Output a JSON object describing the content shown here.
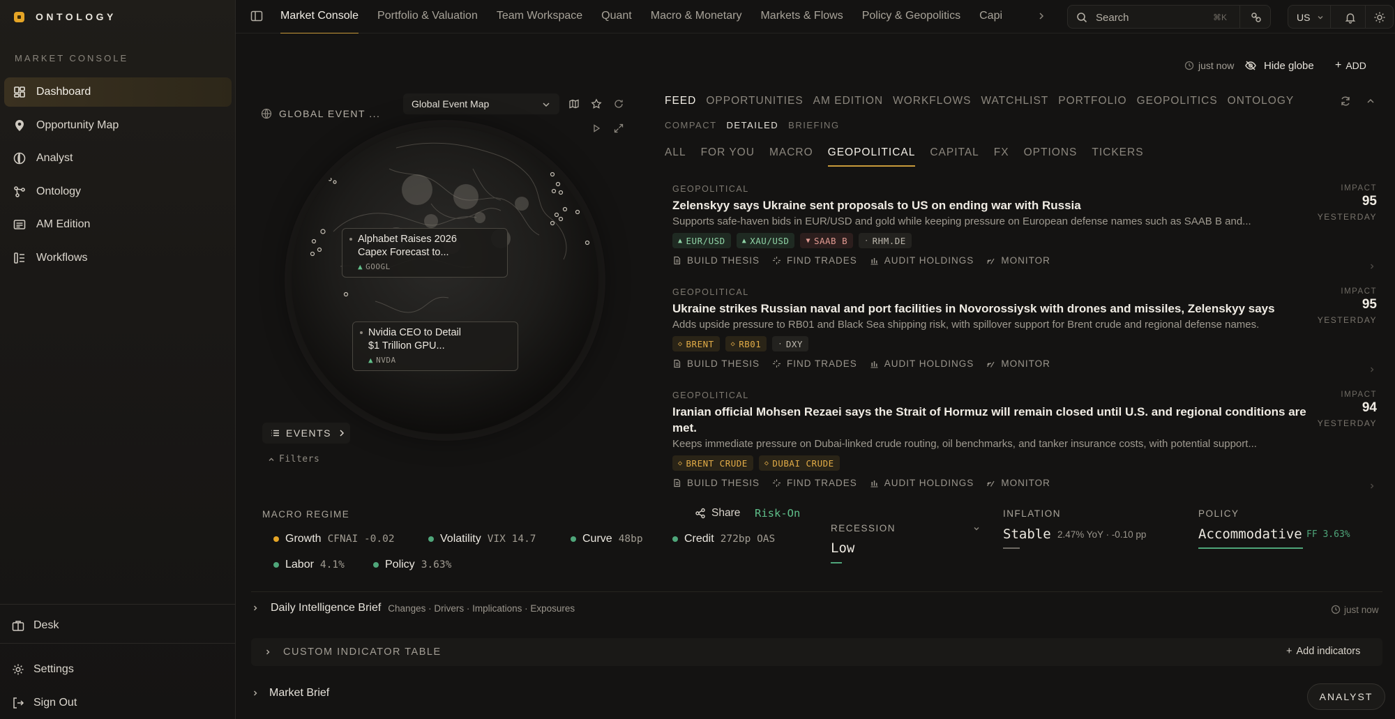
{
  "brand": {
    "name": "ONTOLOGY",
    "accent": "#e5a526"
  },
  "sidebar": {
    "section_label": "MARKET CONSOLE",
    "items": [
      {
        "label": "Dashboard",
        "icon": "dashboard-icon",
        "active": true
      },
      {
        "label": "Opportunity Map",
        "icon": "map-pin-icon"
      },
      {
        "label": "Analyst",
        "icon": "compass-icon"
      },
      {
        "label": "Ontology",
        "icon": "graph-icon"
      },
      {
        "label": "AM Edition",
        "icon": "newspaper-icon"
      },
      {
        "label": "Workflows",
        "icon": "workflow-icon"
      }
    ],
    "bottom": [
      {
        "label": "Desk",
        "icon": "briefcase-icon"
      },
      {
        "label": "Settings",
        "icon": "gear-icon"
      },
      {
        "label": "Sign Out",
        "icon": "sign-out-icon"
      }
    ]
  },
  "topbar": {
    "tabs": [
      "Market Console",
      "Portfolio & Valuation",
      "Team Workspace",
      "Quant",
      "Macro & Monetary",
      "Markets & Flows",
      "Policy & Geopolitics",
      "Capi"
    ],
    "active_tab": "Market Console",
    "search_placeholder": "Search",
    "search_shortcut": "⌘K",
    "region": "US"
  },
  "header": {
    "updated": "just now",
    "hide_globe": "Hide globe",
    "add": "ADD"
  },
  "globe": {
    "title": "GLOBAL EVENT ...",
    "map_select": "Global Event Map",
    "callouts": [
      {
        "line1": "Alphabet Raises 2026",
        "line2": "Capex Forecast to...",
        "ticker": "GOOGL"
      },
      {
        "line1": "Nvidia CEO to Detail",
        "line2": "$1 Trillion GPU...",
        "ticker": "NVDA"
      }
    ],
    "events_label": "EVENTS",
    "filters_label": "Filters"
  },
  "feed": {
    "tabs": [
      "FEED",
      "OPPORTUNITIES",
      "AM EDITION",
      "WORKFLOWS",
      "WATCHLIST",
      "PORTFOLIO",
      "GEOPOLITICS",
      "ONTOLOGY"
    ],
    "views": [
      "COMPACT",
      "DETAILED",
      "BRIEFING"
    ],
    "categories": [
      "ALL",
      "FOR YOU",
      "MACRO",
      "GEOPOLITICAL",
      "CAPITAL",
      "FX",
      "OPTIONS",
      "TICKERS"
    ],
    "impact_label": "IMPACT",
    "actions": [
      "BUILD THESIS",
      "FIND TRADES",
      "AUDIT HOLDINGS",
      "MONITOR"
    ],
    "items": [
      {
        "category": "GEOPOLITICAL",
        "headline": "Zelenskyy says Ukraine sent proposals to US on ending war with Russia",
        "summary": "Supports safe-haven bids in EUR/USD and gold while keeping pressure on European defense names such as SAAB B and...",
        "impact": "95",
        "when": "YESTERDAY",
        "chips": [
          {
            "label": "EUR/USD",
            "kind": "up",
            "mark": "▲"
          },
          {
            "label": "XAU/USD",
            "kind": "up",
            "mark": "▲"
          },
          {
            "label": "SAAB B",
            "kind": "down",
            "mark": "▼"
          },
          {
            "label": "RHM.DE",
            "kind": "nt",
            "mark": "·"
          }
        ]
      },
      {
        "category": "GEOPOLITICAL",
        "headline": "Ukraine strikes Russian naval and port facilities in Novorossiysk with drones and missiles, Zelenskyy says",
        "summary": "Adds upside pressure to RB01 and Black Sea shipping risk, with spillover support for Brent crude and regional defense names.",
        "impact": "95",
        "when": "YESTERDAY",
        "chips": [
          {
            "label": "BRENT",
            "kind": "ws",
            "mark": "◇"
          },
          {
            "label": "RB01",
            "kind": "ws",
            "mark": "◇"
          },
          {
            "label": "DXY",
            "kind": "nt",
            "mark": "·"
          }
        ]
      },
      {
        "category": "GEOPOLITICAL",
        "headline": "Iranian official Mohsen Rezaei says the Strait of Hormuz will remain closed until U.S. and regional conditions are met.",
        "summary": "Keeps immediate pressure on Dubai-linked crude routing, oil benchmarks, and tanker insurance costs, with potential support...",
        "impact": "94",
        "when": "YESTERDAY",
        "chips": [
          {
            "label": "BRENT CRUDE",
            "kind": "ws",
            "mark": "◇"
          },
          {
            "label": "DUBAI CRUDE",
            "kind": "ws",
            "mark": "◇"
          }
        ]
      }
    ]
  },
  "macro": {
    "title": "MACRO REGIME",
    "items": [
      {
        "label": "Growth",
        "value": "CFNAI -0.02",
        "color": "#e5a526"
      },
      {
        "label": "Volatility",
        "value": "VIX 14.7",
        "color": "#4fa67a"
      },
      {
        "label": "Curve",
        "value": "48bp",
        "color": "#4fa67a"
      },
      {
        "label": "Credit",
        "value": "272bp OAS",
        "color": "#4fa67a"
      },
      {
        "label": "Labor",
        "value": "4.1%",
        "color": "#4fa67a"
      },
      {
        "label": "Policy",
        "value": "3.63%",
        "color": "#4fa67a"
      }
    ],
    "share": "Share",
    "regime": "Risk-On",
    "recession": {
      "label": "RECESSION",
      "value": "Low"
    },
    "inflation": {
      "label": "INFLATION",
      "value": "Stable",
      "detail": "2.47% YoY · -0.10 pp"
    },
    "policy": {
      "label": "POLICY",
      "value": "Accommodative",
      "detail": "FF 3.63%"
    }
  },
  "brief": {
    "title": "Daily Intelligence Brief",
    "subtitle": "Changes · Drivers · Implications · Exposures",
    "updated": "just now"
  },
  "custom_table": {
    "title": "CUSTOM INDICATOR TABLE",
    "add": "Add indicators"
  },
  "market_brief": {
    "title": "Market Brief"
  },
  "analyst_button": "ANALYST"
}
